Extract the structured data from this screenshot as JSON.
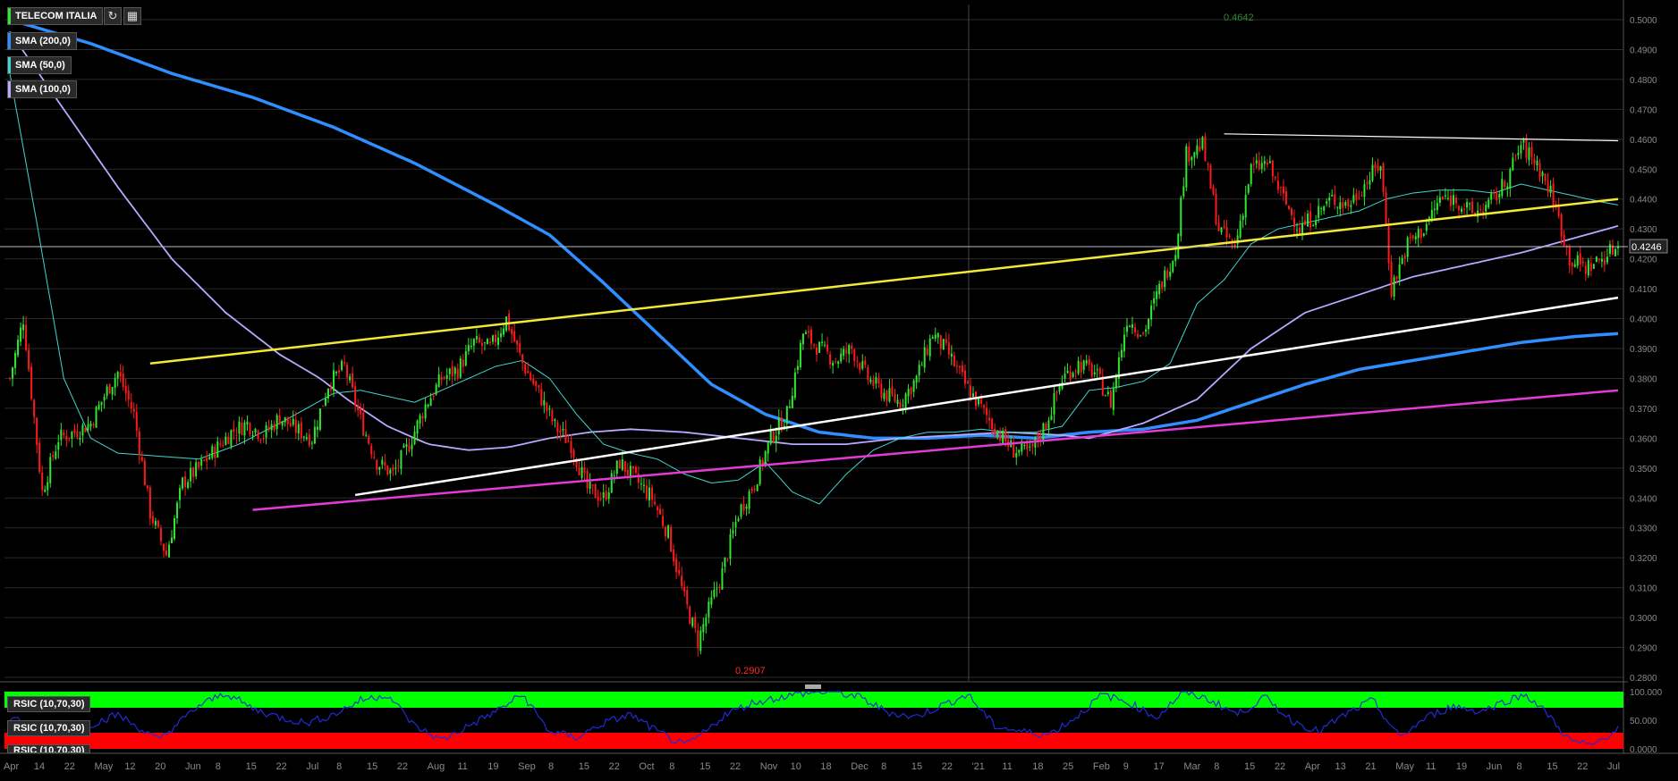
{
  "instrument": "TELECOM ITALIA",
  "toolbar": {
    "refresh_icon": "refresh-icon",
    "calendar_icon": "calendar-icon"
  },
  "legend": [
    {
      "label": "SMA (200,0)",
      "color": "#2f8fff"
    },
    {
      "label": "SMA (50,0)",
      "color": "#3fd6d0"
    },
    {
      "label": "SMA (100,0)",
      "color": "#b9a8ff"
    }
  ],
  "rsi_labels": [
    "RSIC (10,70,30)",
    "RSIC (10,70,30)",
    "RSIC (10,70,30)"
  ],
  "colors": {
    "up": "#2ee82e",
    "down": "#ff1a1a",
    "trend_yellow": "#f2e83a",
    "trend_white": "#ffffff",
    "trend_magenta": "#e43ad6",
    "rsi_line": "#1f2bd6",
    "rsi_green": "#00ff00",
    "rsi_red": "#ff0000"
  },
  "chart_data": {
    "type": "candlestick",
    "price_axis": {
      "min": 0.28,
      "max": 0.5,
      "step": 0.01,
      "decimals": 4
    },
    "last_price": "0.4246",
    "high_annotation": "0.4642",
    "low_annotation": "0.2907",
    "x_ticks": [
      "Apr",
      "14",
      "22",
      "May",
      "12",
      "20",
      "Jun",
      "8",
      "15",
      "22",
      "Jul",
      "8",
      "15",
      "22",
      "Aug",
      "11",
      "19",
      "Sep",
      "8",
      "15",
      "22",
      "Oct",
      "8",
      "15",
      "22",
      "Nov",
      "10",
      "18",
      "Dec",
      "8",
      "15",
      "22",
      "'21",
      "11",
      "18",
      "25",
      "Feb",
      "9",
      "17",
      "Mar",
      "8",
      "15",
      "22",
      "Apr",
      "13",
      "21",
      "May",
      "11",
      "19",
      "Jun",
      "8",
      "15",
      "22",
      "Jul"
    ],
    "anchors": [
      [
        0,
        0.38
      ],
      [
        5,
        0.4
      ],
      [
        12,
        0.342
      ],
      [
        18,
        0.36
      ],
      [
        24,
        0.362
      ],
      [
        30,
        0.365
      ],
      [
        36,
        0.376
      ],
      [
        40,
        0.382
      ],
      [
        46,
        0.368
      ],
      [
        52,
        0.335
      ],
      [
        58,
        0.321
      ],
      [
        64,
        0.345
      ],
      [
        70,
        0.35
      ],
      [
        76,
        0.356
      ],
      [
        82,
        0.362
      ],
      [
        88,
        0.365
      ],
      [
        94,
        0.361
      ],
      [
        100,
        0.367
      ],
      [
        106,
        0.363
      ],
      [
        112,
        0.36
      ],
      [
        118,
        0.378
      ],
      [
        124,
        0.384
      ],
      [
        130,
        0.366
      ],
      [
        136,
        0.352
      ],
      [
        142,
        0.348
      ],
      [
        148,
        0.358
      ],
      [
        154,
        0.371
      ],
      [
        160,
        0.38
      ],
      [
        166,
        0.383
      ],
      [
        172,
        0.392
      ],
      [
        178,
        0.39
      ],
      [
        184,
        0.4
      ],
      [
        190,
        0.385
      ],
      [
        196,
        0.375
      ],
      [
        202,
        0.364
      ],
      [
        208,
        0.358
      ],
      [
        214,
        0.343
      ],
      [
        220,
        0.34
      ],
      [
        226,
        0.352
      ],
      [
        232,
        0.346
      ],
      [
        238,
        0.34
      ],
      [
        244,
        0.328
      ],
      [
        250,
        0.306
      ],
      [
        255,
        0.292
      ],
      [
        258,
        0.3
      ],
      [
        264,
        0.315
      ],
      [
        270,
        0.335
      ],
      [
        276,
        0.345
      ],
      [
        282,
        0.36
      ],
      [
        288,
        0.368
      ],
      [
        294,
        0.395
      ],
      [
        300,
        0.39
      ],
      [
        306,
        0.386
      ],
      [
        312,
        0.39
      ],
      [
        318,
        0.38
      ],
      [
        324,
        0.375
      ],
      [
        330,
        0.372
      ],
      [
        336,
        0.38
      ],
      [
        342,
        0.395
      ],
      [
        348,
        0.388
      ],
      [
        354,
        0.378
      ],
      [
        360,
        0.37
      ],
      [
        366,
        0.362
      ],
      [
        372,
        0.356
      ],
      [
        378,
        0.355
      ],
      [
        384,
        0.365
      ],
      [
        390,
        0.38
      ],
      [
        396,
        0.385
      ],
      [
        402,
        0.382
      ],
      [
        408,
        0.372
      ],
      [
        414,
        0.4
      ],
      [
        420,
        0.395
      ],
      [
        426,
        0.41
      ],
      [
        432,
        0.423
      ],
      [
        436,
        0.455
      ],
      [
        442,
        0.458
      ],
      [
        448,
        0.43
      ],
      [
        454,
        0.424
      ],
      [
        460,
        0.45
      ],
      [
        466,
        0.452
      ],
      [
        472,
        0.44
      ],
      [
        478,
        0.43
      ],
      [
        484,
        0.435
      ],
      [
        490,
        0.44
      ],
      [
        496,
        0.438
      ],
      [
        502,
        0.445
      ],
      [
        508,
        0.452
      ],
      [
        512,
        0.41
      ],
      [
        518,
        0.425
      ],
      [
        524,
        0.43
      ],
      [
        530,
        0.44
      ],
      [
        536,
        0.44
      ],
      [
        542,
        0.435
      ],
      [
        548,
        0.438
      ],
      [
        554,
        0.445
      ],
      [
        560,
        0.458
      ],
      [
        566,
        0.452
      ],
      [
        572,
        0.44
      ],
      [
        578,
        0.42
      ],
      [
        584,
        0.417
      ],
      [
        590,
        0.42
      ],
      [
        596,
        0.4246
      ]
    ],
    "sma50_anchors": [
      [
        0,
        0.482
      ],
      [
        10,
        0.432
      ],
      [
        20,
        0.38
      ],
      [
        30,
        0.36
      ],
      [
        40,
        0.355
      ],
      [
        55,
        0.354
      ],
      [
        70,
        0.353
      ],
      [
        85,
        0.358
      ],
      [
        100,
        0.365
      ],
      [
        110,
        0.37
      ],
      [
        120,
        0.375
      ],
      [
        130,
        0.376
      ],
      [
        140,
        0.374
      ],
      [
        150,
        0.372
      ],
      [
        160,
        0.376
      ],
      [
        170,
        0.38
      ],
      [
        180,
        0.384
      ],
      [
        190,
        0.386
      ],
      [
        200,
        0.38
      ],
      [
        210,
        0.368
      ],
      [
        220,
        0.358
      ],
      [
        230,
        0.355
      ],
      [
        240,
        0.353
      ],
      [
        250,
        0.348
      ],
      [
        260,
        0.345
      ],
      [
        270,
        0.346
      ],
      [
        280,
        0.352
      ],
      [
        290,
        0.342
      ],
      [
        300,
        0.338
      ],
      [
        310,
        0.348
      ],
      [
        320,
        0.356
      ],
      [
        330,
        0.36
      ],
      [
        340,
        0.362
      ],
      [
        350,
        0.362
      ],
      [
        360,
        0.363
      ],
      [
        370,
        0.362
      ],
      [
        380,
        0.362
      ],
      [
        390,
        0.364
      ],
      [
        400,
        0.376
      ],
      [
        410,
        0.377
      ],
      [
        420,
        0.379
      ],
      [
        430,
        0.385
      ],
      [
        440,
        0.405
      ],
      [
        450,
        0.413
      ],
      [
        460,
        0.425
      ],
      [
        470,
        0.43
      ],
      [
        480,
        0.432
      ],
      [
        490,
        0.434
      ],
      [
        500,
        0.436
      ],
      [
        510,
        0.44
      ],
      [
        520,
        0.442
      ],
      [
        530,
        0.443
      ],
      [
        540,
        0.443
      ],
      [
        550,
        0.442
      ],
      [
        560,
        0.445
      ],
      [
        570,
        0.443
      ],
      [
        580,
        0.441
      ],
      [
        590,
        0.439
      ],
      [
        596,
        0.438
      ]
    ],
    "sma100_anchors": [
      [
        0,
        0.496
      ],
      [
        20,
        0.47
      ],
      [
        40,
        0.444
      ],
      [
        60,
        0.42
      ],
      [
        80,
        0.402
      ],
      [
        100,
        0.388
      ],
      [
        115,
        0.38
      ],
      [
        125,
        0.373
      ],
      [
        140,
        0.364
      ],
      [
        155,
        0.358
      ],
      [
        170,
        0.356
      ],
      [
        185,
        0.357
      ],
      [
        200,
        0.36
      ],
      [
        215,
        0.362
      ],
      [
        230,
        0.363
      ],
      [
        250,
        0.362
      ],
      [
        270,
        0.36
      ],
      [
        290,
        0.358
      ],
      [
        310,
        0.358
      ],
      [
        330,
        0.36
      ],
      [
        350,
        0.361
      ],
      [
        370,
        0.362
      ],
      [
        390,
        0.361
      ],
      [
        400,
        0.36
      ],
      [
        420,
        0.365
      ],
      [
        440,
        0.373
      ],
      [
        460,
        0.39
      ],
      [
        480,
        0.402
      ],
      [
        500,
        0.408
      ],
      [
        520,
        0.414
      ],
      [
        540,
        0.418
      ],
      [
        560,
        0.422
      ],
      [
        580,
        0.427
      ],
      [
        596,
        0.431
      ]
    ],
    "sma200_anchors": [
      [
        0,
        0.5
      ],
      [
        30,
        0.492
      ],
      [
        60,
        0.482
      ],
      [
        90,
        0.474
      ],
      [
        120,
        0.464
      ],
      [
        150,
        0.452
      ],
      [
        180,
        0.438
      ],
      [
        200,
        0.428
      ],
      [
        220,
        0.412
      ],
      [
        240,
        0.395
      ],
      [
        260,
        0.378
      ],
      [
        280,
        0.368
      ],
      [
        300,
        0.362
      ],
      [
        320,
        0.36
      ],
      [
        340,
        0.36
      ],
      [
        360,
        0.361
      ],
      [
        380,
        0.36
      ],
      [
        400,
        0.362
      ],
      [
        420,
        0.363
      ],
      [
        440,
        0.366
      ],
      [
        460,
        0.372
      ],
      [
        480,
        0.378
      ],
      [
        500,
        0.383
      ],
      [
        520,
        0.386
      ],
      [
        540,
        0.389
      ],
      [
        560,
        0.392
      ],
      [
        580,
        0.394
      ],
      [
        596,
        0.395
      ]
    ],
    "trendlines": [
      {
        "color": "trend_yellow",
        "from": [
          52,
          0.385
        ],
        "to": [
          596,
          0.44
        ]
      },
      {
        "color": "trend_white",
        "from": [
          128,
          0.341
        ],
        "to": [
          596,
          0.407
        ]
      },
      {
        "color": "trend_magenta",
        "from": [
          90,
          0.336
        ],
        "to": [
          596,
          0.376
        ]
      },
      {
        "color": "trend_white",
        "from": [
          450,
          0.4618
        ],
        "to": [
          596,
          0.4595
        ]
      }
    ],
    "rsi_axis_ticks": [
      "100.000",
      "50.000",
      "0.0000"
    ],
    "rsi_anchors": [
      [
        0,
        55
      ],
      [
        20,
        25
      ],
      [
        40,
        60
      ],
      [
        55,
        15
      ],
      [
        70,
        75
      ],
      [
        80,
        98
      ],
      [
        90,
        70
      ],
      [
        100,
        55
      ],
      [
        110,
        45
      ],
      [
        120,
        60
      ],
      [
        130,
        85
      ],
      [
        140,
        95
      ],
      [
        150,
        40
      ],
      [
        160,
        15
      ],
      [
        170,
        40
      ],
      [
        180,
        65
      ],
      [
        190,
        95
      ],
      [
        200,
        30
      ],
      [
        210,
        20
      ],
      [
        220,
        45
      ],
      [
        230,
        60
      ],
      [
        240,
        30
      ],
      [
        250,
        5
      ],
      [
        258,
        30
      ],
      [
        265,
        60
      ],
      [
        275,
        80
      ],
      [
        285,
        90
      ],
      [
        295,
        98
      ],
      [
        305,
        100
      ],
      [
        315,
        90
      ],
      [
        325,
        65
      ],
      [
        335,
        55
      ],
      [
        345,
        75
      ],
      [
        355,
        95
      ],
      [
        365,
        40
      ],
      [
        375,
        30
      ],
      [
        385,
        25
      ],
      [
        395,
        55
      ],
      [
        405,
        95
      ],
      [
        415,
        80
      ],
      [
        425,
        55
      ],
      [
        435,
        100
      ],
      [
        445,
        85
      ],
      [
        455,
        60
      ],
      [
        465,
        90
      ],
      [
        475,
        50
      ],
      [
        485,
        30
      ],
      [
        495,
        60
      ],
      [
        505,
        85
      ],
      [
        515,
        20
      ],
      [
        525,
        55
      ],
      [
        535,
        75
      ],
      [
        545,
        65
      ],
      [
        555,
        85
      ],
      [
        562,
        95
      ],
      [
        570,
        60
      ],
      [
        578,
        15
      ],
      [
        586,
        5
      ],
      [
        596,
        35
      ]
    ]
  }
}
